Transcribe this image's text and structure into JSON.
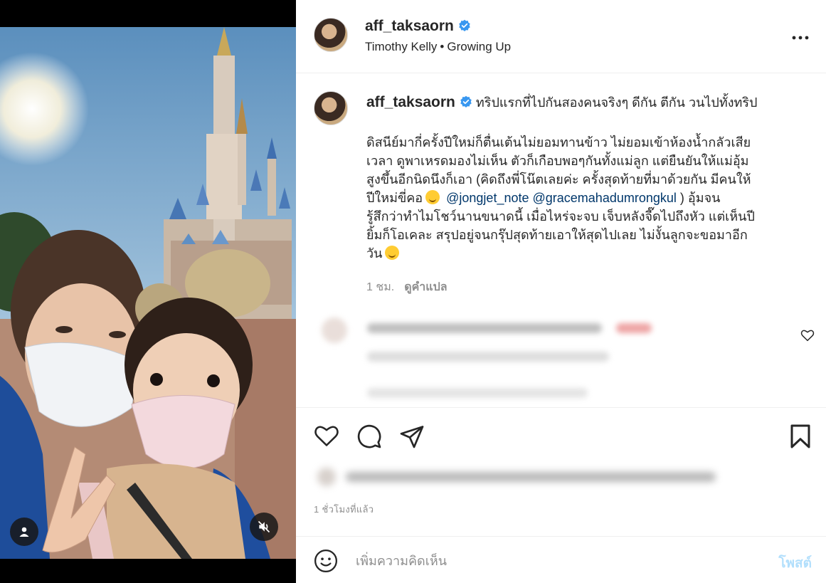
{
  "post": {
    "username": "aff_taksaorn",
    "music": {
      "artist": "Timothy Kelly",
      "separator": "•",
      "song": "Growing Up"
    },
    "caption_first": "ทริปแรกที่ไปกันสองคนจริงๆ ดีกัน ตีกัน วนไปทั้งทริป",
    "caption_lines": [
      "ดิสนีย์มากี่ครั้งปีใหม่ก็ตื่นเต้นไม่ยอมทานข้าว ไม่ยอมเข้าห้องน้ำกลัวเสีย",
      "เวลา ดูพาเหรดมองไม่เห็น ตัวก็เกือบพอๆกันทั้งแม่ลูก แต่ยืนยันให้แม่อุ้ม",
      "สูงขึ้นอีกนิดนึงก็เอา (คิดถึงพี่โน๊ตเลยค่ะ ครั้งสุดท้ายที่มาด้วยกัน มีคนให้"
    ],
    "caption_line4_start": "ปีใหม่ขี่คอ",
    "mention_1": "@jongjet_note",
    "mention_2": "@gracemahadumrongkul",
    "caption_line4_end": " ) อุ้มจน",
    "caption_lines_after": [
      "รู้สึกว่าทำไมโชว์นานขนาดนี้ เมื่อไหร่จะจบ เจ็บหลังจี๊ดไปถึงหัว แต่เห็นปี",
      "ยิ้มก็โอเคละ สรุปอยู่จนกรุ๊ปสุดท้ายเอาให้สุดไปเลย ไม่งั้นลูกจะขอมาอีก"
    ],
    "caption_last": "วัน",
    "caption_age": "1 ชม.",
    "translate_label": "ดูคำแปล",
    "posted_ago": "1 ชั่วโมงที่แล้ว"
  },
  "comment_box": {
    "placeholder": "เพิ่มความคิดเห็น",
    "post_label": "โพสต์"
  },
  "colors": {
    "verified": "#3897f0",
    "mention": "#00376b",
    "post_button_disabled": "#b2dffc",
    "muted_text": "#8e8e8e"
  },
  "icons": [
    "user-tag-icon",
    "mute-icon",
    "more-options-icon",
    "verified-badge-icon",
    "heart-icon",
    "comment-icon",
    "share-icon",
    "bookmark-icon",
    "emoji-icon"
  ]
}
